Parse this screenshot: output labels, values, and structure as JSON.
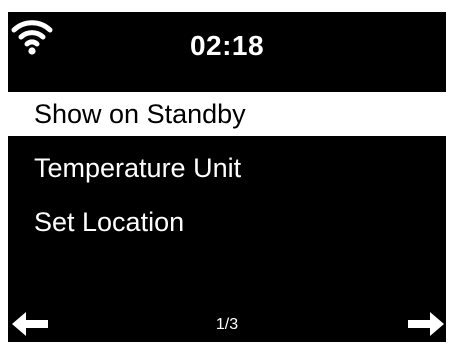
{
  "status_bar": {
    "time": "02:18",
    "wifi_icon": "wifi-icon"
  },
  "menu": {
    "items": [
      {
        "label": "Show on Standby",
        "selected": true
      },
      {
        "label": "Temperature Unit",
        "selected": false
      },
      {
        "label": "Set Location",
        "selected": false
      }
    ]
  },
  "footer": {
    "page_indicator": "1/3",
    "left_icon": "arrow-left-icon",
    "right_icon": "arrow-right-icon"
  },
  "colors": {
    "background": "#000000",
    "foreground": "#ffffff",
    "selection_background": "#ffffff",
    "selection_text": "#000000"
  }
}
